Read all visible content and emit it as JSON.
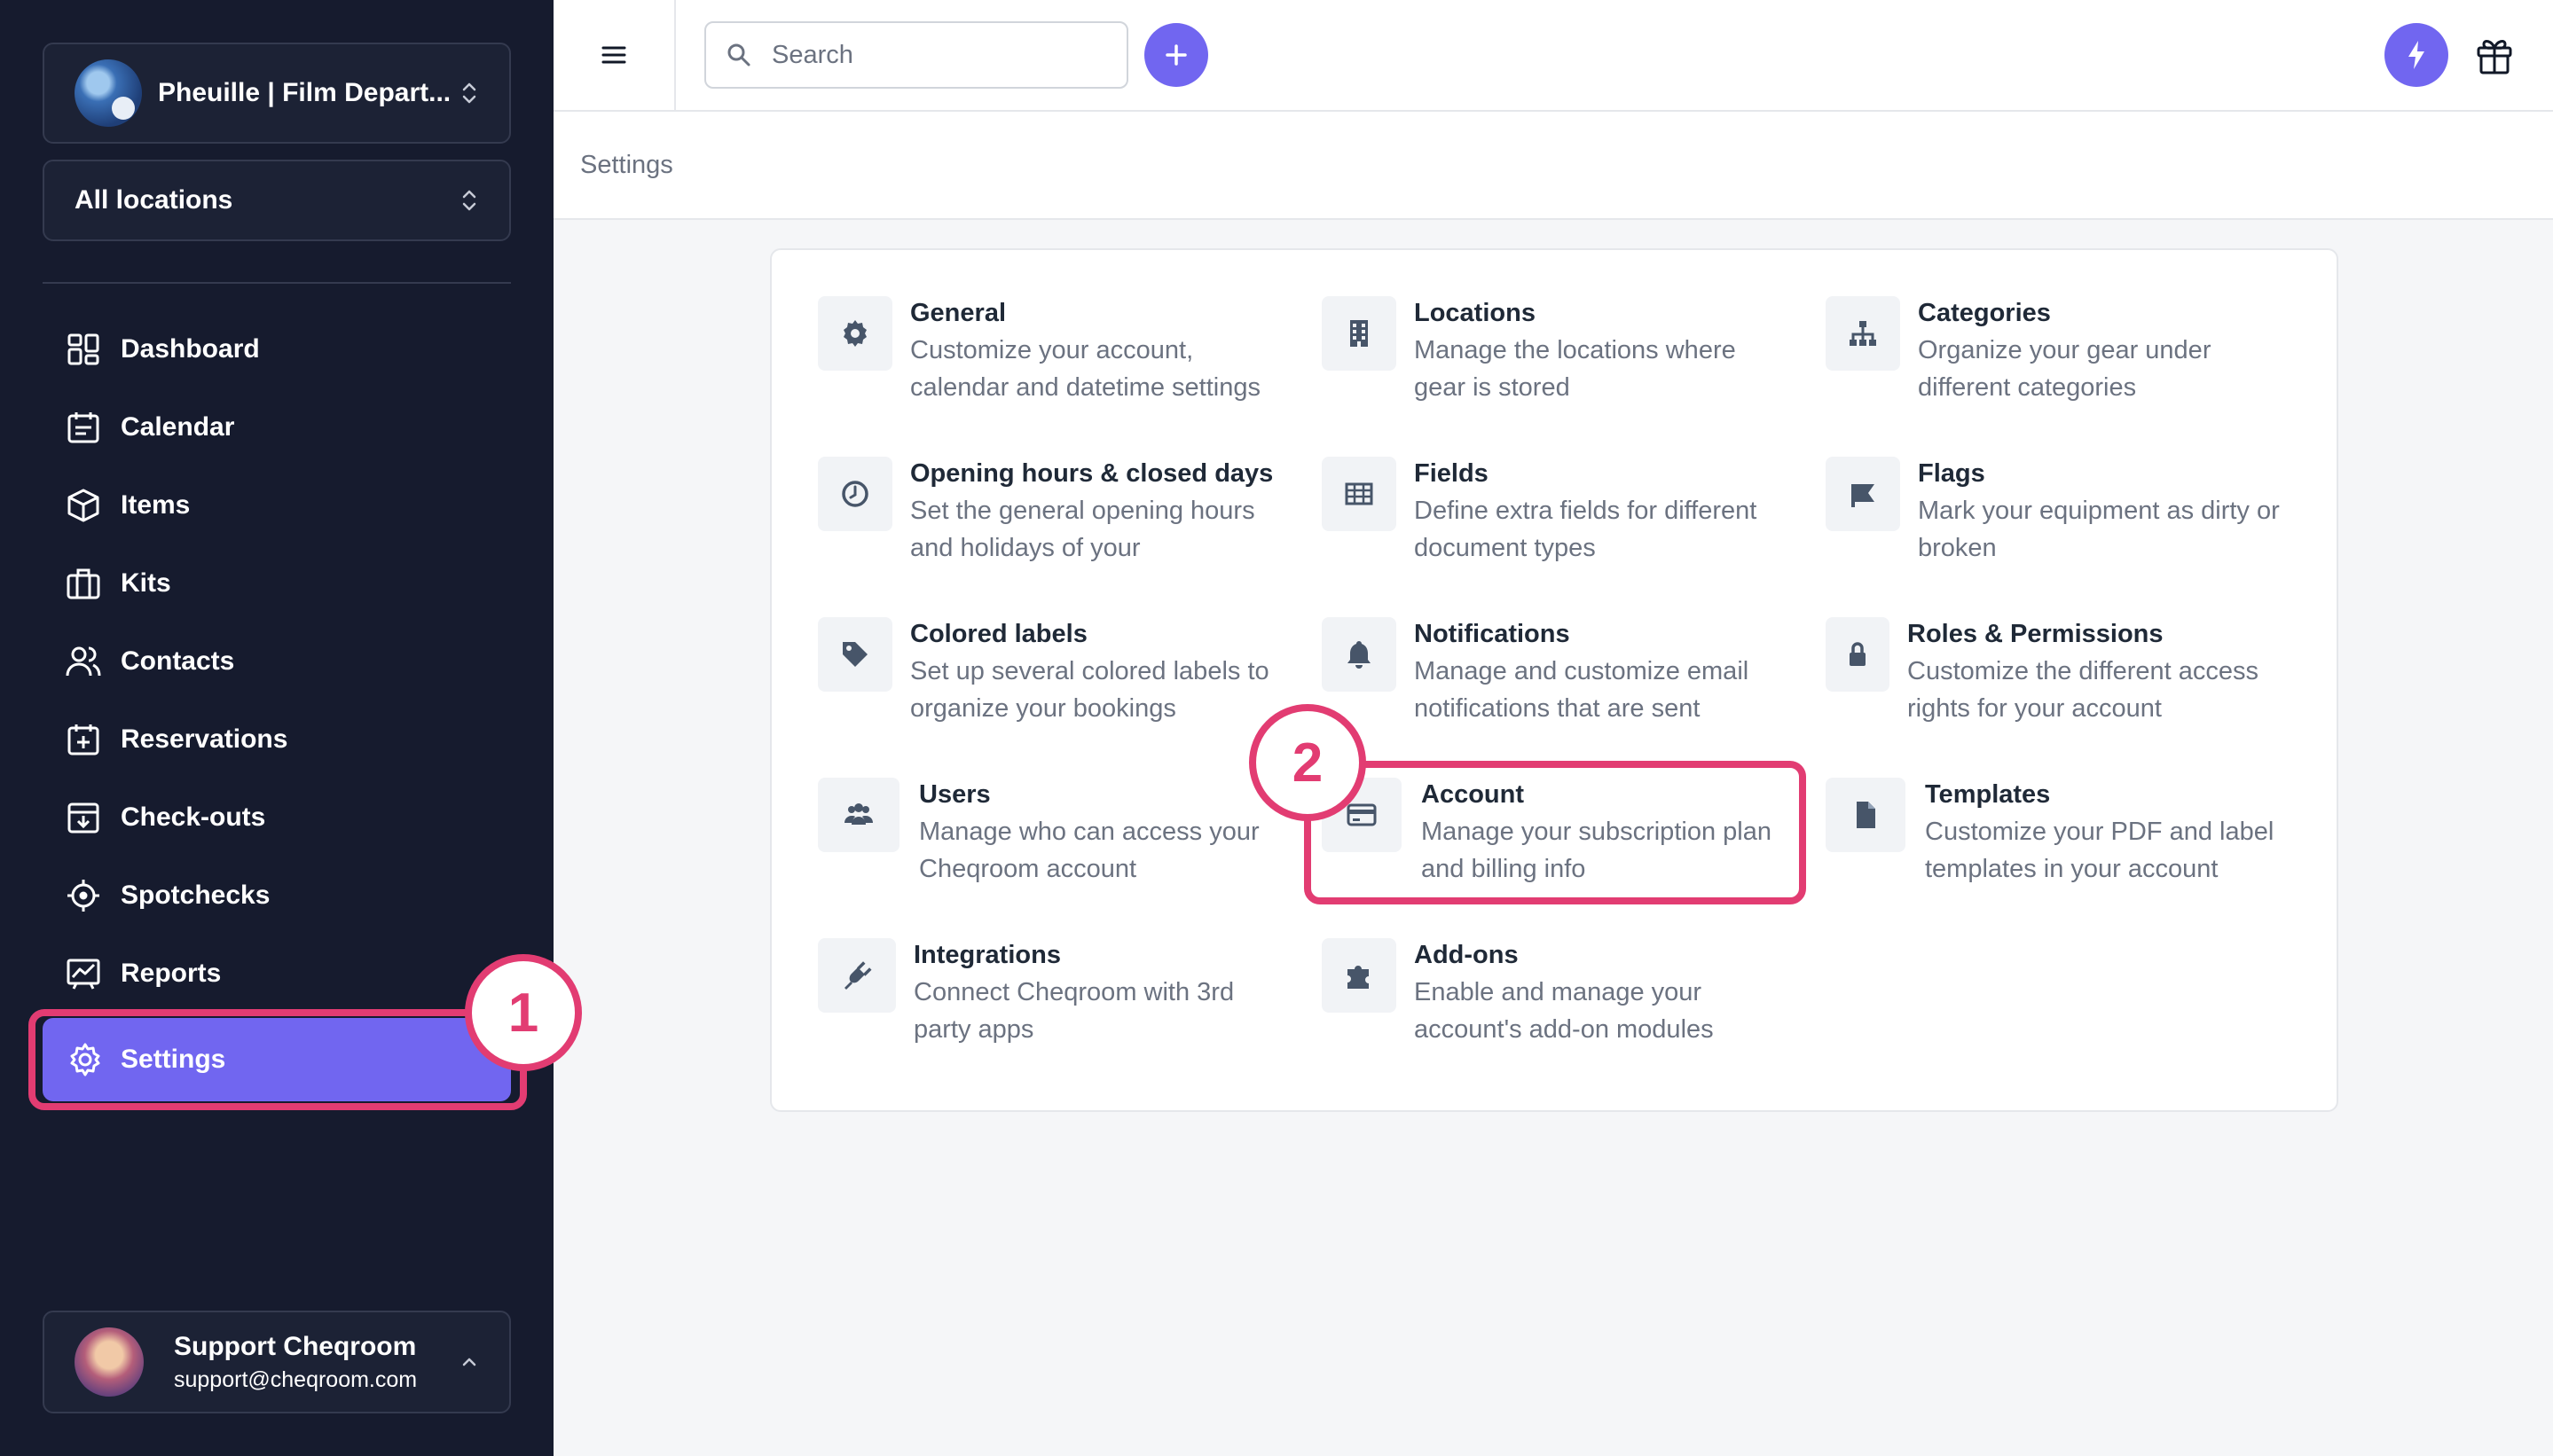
{
  "sidebar": {
    "org_name": "Pheuille | Film Depart...",
    "location": "All locations",
    "nav": [
      {
        "label": "Dashboard",
        "icon": "dashboard-icon"
      },
      {
        "label": "Calendar",
        "icon": "calendar-icon"
      },
      {
        "label": "Items",
        "icon": "box-icon"
      },
      {
        "label": "Kits",
        "icon": "kit-icon"
      },
      {
        "label": "Contacts",
        "icon": "contacts-icon"
      },
      {
        "label": "Reservations",
        "icon": "reservation-icon"
      },
      {
        "label": "Check-outs",
        "icon": "checkout-icon"
      },
      {
        "label": "Spotchecks",
        "icon": "crosshair-icon"
      },
      {
        "label": "Reports",
        "icon": "chart-icon"
      }
    ],
    "active": {
      "label": "Settings",
      "icon": "gear-icon"
    },
    "user": {
      "name": "Support Cheqroom",
      "email": "support@cheqroom.com"
    }
  },
  "topbar": {
    "search_placeholder": "Search"
  },
  "page": {
    "title": "Settings"
  },
  "annotations": {
    "step1": "1",
    "step2": "2"
  },
  "tiles": [
    {
      "title": "General",
      "desc": "Customize your account, calendar and datetime settings",
      "icon": "gear-icon"
    },
    {
      "title": "Locations",
      "desc": "Manage the locations where gear is stored",
      "icon": "building-icon"
    },
    {
      "title": "Categories",
      "desc": "Organize your gear under different categories",
      "icon": "hierarchy-icon"
    },
    {
      "title": "Opening hours & closed days",
      "desc": "Set the general opening hours and holidays of your",
      "icon": "clock-icon"
    },
    {
      "title": "Fields",
      "desc": "Define extra fields for different document types",
      "icon": "table-icon"
    },
    {
      "title": "Flags",
      "desc": "Mark your equipment as dirty or broken",
      "icon": "flag-icon"
    },
    {
      "title": "Colored labels",
      "desc": "Set up several colored labels to organize your bookings",
      "icon": "tag-icon"
    },
    {
      "title": "Notifications",
      "desc": "Manage and customize email notifications that are sent",
      "icon": "bell-icon"
    },
    {
      "title": "Roles & Permissions",
      "desc": "Customize the different access rights for your account",
      "icon": "lock-icon"
    },
    {
      "title": "Users",
      "desc": "Manage who can access your Cheqroom account",
      "icon": "users-icon"
    },
    {
      "title": "Account",
      "desc": "Manage your subscription plan and billing info",
      "icon": "credit-card-icon"
    },
    {
      "title": "Templates",
      "desc": "Customize your PDF and label templates in your account",
      "icon": "document-icon"
    },
    {
      "title": "Integrations",
      "desc": "Connect Cheqroom with 3rd party apps",
      "icon": "plug-icon"
    },
    {
      "title": "Add-ons",
      "desc": "Enable and manage your account's add-on modules",
      "icon": "puzzle-icon"
    }
  ],
  "colors": {
    "sidebar_bg": "#161b2e",
    "accent": "#7166f0",
    "highlight": "#e23c72"
  }
}
